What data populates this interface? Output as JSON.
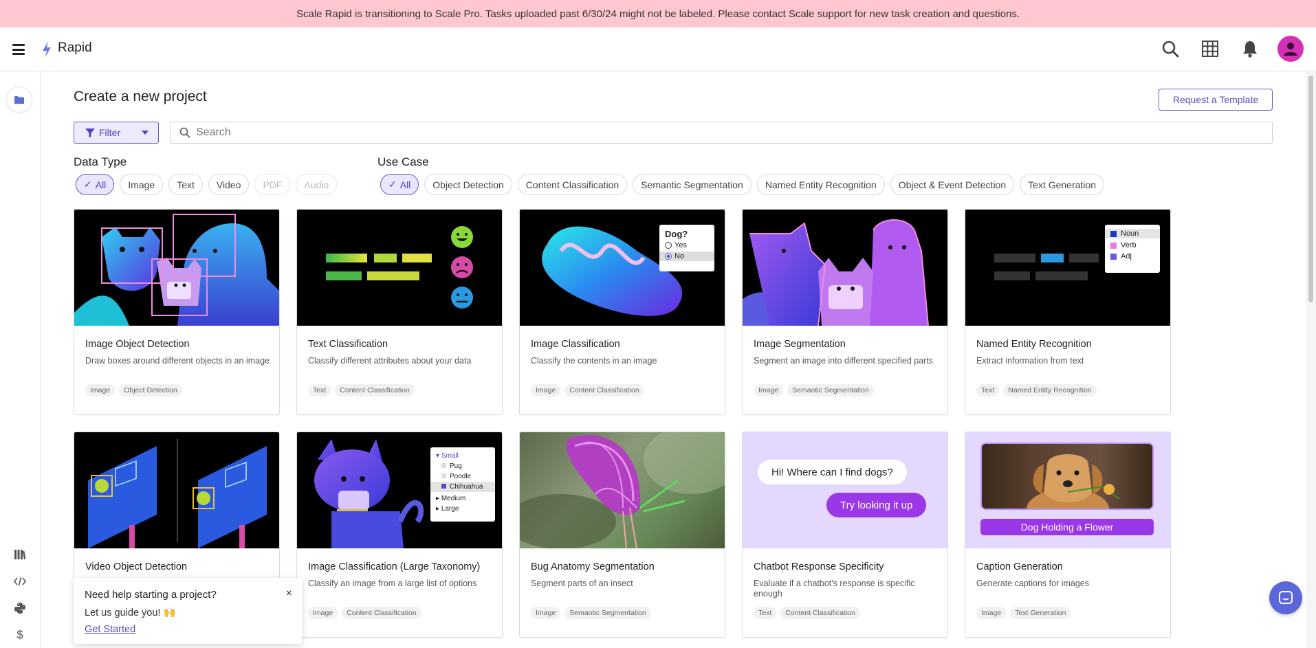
{
  "banner": {
    "text": "Scale Rapid is transitioning to Scale Pro. Tasks uploaded past 6/30/24 might not be labeled. Please contact Scale support for new task creation and questions."
  },
  "header": {
    "app_title": "Rapid"
  },
  "page": {
    "title": "Create a new project",
    "request_template": "Request a Template"
  },
  "filter": {
    "label": "Filter"
  },
  "search": {
    "placeholder": "Search"
  },
  "data_type": {
    "label": "Data Type",
    "chips": [
      {
        "label": "All",
        "state": "active"
      },
      {
        "label": "Image",
        "state": "normal"
      },
      {
        "label": "Text",
        "state": "normal"
      },
      {
        "label": "Video",
        "state": "normal"
      },
      {
        "label": "PDF",
        "state": "disabled"
      },
      {
        "label": "Audio",
        "state": "disabled"
      }
    ]
  },
  "use_case": {
    "label": "Use Case",
    "chips": [
      {
        "label": "All",
        "state": "active"
      },
      {
        "label": "Object Detection",
        "state": "normal"
      },
      {
        "label": "Content Classification",
        "state": "normal"
      },
      {
        "label": "Semantic Segmentation",
        "state": "normal"
      },
      {
        "label": "Named Entity Recognition",
        "state": "normal"
      },
      {
        "label": "Object & Event Detection",
        "state": "normal"
      },
      {
        "label": "Text Generation",
        "state": "normal"
      }
    ]
  },
  "cards": [
    {
      "title": "Image Object Detection",
      "desc": "Draw boxes around different objects in an image",
      "tags": [
        "Image",
        "Object Detection"
      ]
    },
    {
      "title": "Text Classification",
      "desc": "Classify different attributes about your data",
      "tags": [
        "Text",
        "Content Classification"
      ]
    },
    {
      "title": "Image Classification",
      "desc": "Classify the contents in an image",
      "tags": [
        "Image",
        "Content Classification"
      ]
    },
    {
      "title": "Image Segmentation",
      "desc": "Segment an image into different specified parts",
      "tags": [
        "Image",
        "Semantic Segmentation"
      ]
    },
    {
      "title": "Named Entity Recognition",
      "desc": "Extract information from text",
      "tags": [
        "Text",
        "Named Entity Recognition"
      ]
    },
    {
      "title": "Video Object Detection",
      "desc": "",
      "tags": []
    },
    {
      "title": "Image Classification (Large Taxonomy)",
      "desc": "Classify an image from a large list of options",
      "tags": [
        "Image",
        "Content Classification"
      ]
    },
    {
      "title": "Bug Anatomy Segmentation",
      "desc": "Segment parts of an insect",
      "tags": [
        "Image",
        "Semantic Segmentation"
      ]
    },
    {
      "title": "Chatbot Response Specificity",
      "desc": "Evaluate if a chatbot's response is specific enough",
      "tags": [
        "Text",
        "Content Classification"
      ]
    },
    {
      "title": "Caption Generation",
      "desc": "Generate captions for images",
      "tags": [
        "Image",
        "Text Generation"
      ]
    }
  ],
  "thumb_text": {
    "dog_question": "Dog?",
    "yes": "Yes",
    "no": "No",
    "noun": "Noun",
    "verb": "Verb",
    "adj": "Adj",
    "small": "Small",
    "pug": "Pug",
    "poodle": "Poodle",
    "chihuahua": "Chihuahua",
    "medium": "Medium",
    "large": "Large",
    "chat_q": "Hi! Where can I find dogs?",
    "chat_a": "Try looking it up",
    "caption": "Dog Holding a Flower"
  },
  "help": {
    "title": "Need help starting a project?",
    "subtitle": "Let us guide you! 🙌",
    "link": "Get Started",
    "close": "×"
  },
  "colors": {
    "accent": "#5b4bc4",
    "banner": "#ffc8d0",
    "avatar": "#d52fb5"
  }
}
